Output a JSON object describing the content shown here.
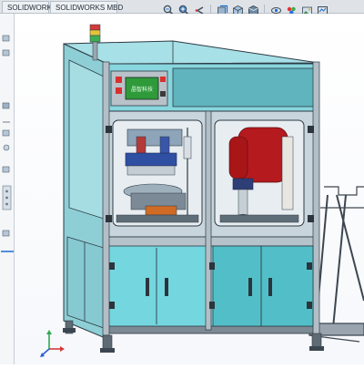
{
  "tabs": [
    {
      "label": "SOLIDWORKS 插件",
      "active": false
    },
    {
      "label": "SOLIDWORKS MBD",
      "active": false
    }
  ],
  "view_toolbar": {
    "buttons": [
      "zoom-to-fit-icon",
      "zoom-area-icon",
      "previous-view-icon",
      "section-view-icon",
      "view-orientation-icon",
      "display-style-icon",
      "hide-show-icon",
      "edit-appearance-icon",
      "apply-scene-icon",
      "view-settings-icon"
    ]
  },
  "model": {
    "hmi_screen_text": "晶智科技",
    "frame_color": "#c9d5dc",
    "panel_color": "#74d6df",
    "accent_red": "#b51a1e"
  },
  "colors": {
    "accent": "#1a6fd1",
    "viewport_bg": "#ffffff"
  }
}
